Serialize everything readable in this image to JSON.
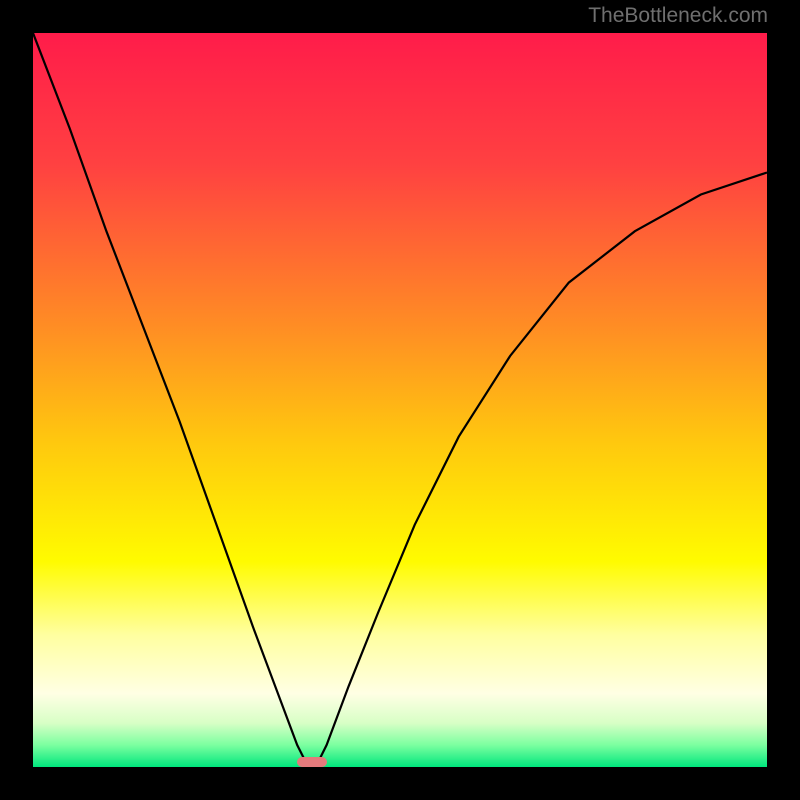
{
  "watermark": "TheBottleneck.com",
  "chart_data": {
    "type": "line",
    "title": "",
    "xlabel": "",
    "ylabel": "",
    "xlim": [
      0,
      100
    ],
    "ylim": [
      0,
      100
    ],
    "minimum_x": 38,
    "marker": {
      "x": 38,
      "width": 4
    },
    "series": [
      {
        "name": "curve",
        "x": [
          0,
          5,
          10,
          15,
          20,
          25,
          30,
          33,
          36,
          37,
          38,
          39,
          40,
          43,
          47,
          52,
          58,
          65,
          73,
          82,
          91,
          100
        ],
        "y": [
          100,
          87,
          73,
          60,
          47,
          33,
          19,
          11,
          3,
          1,
          0,
          1,
          3,
          11,
          21,
          33,
          45,
          56,
          66,
          73,
          78,
          81
        ]
      }
    ],
    "gradient_stops": [
      {
        "pos": 0,
        "color": "#ff1c4a"
      },
      {
        "pos": 18,
        "color": "#ff4141"
      },
      {
        "pos": 40,
        "color": "#ff8d24"
      },
      {
        "pos": 56,
        "color": "#ffc90e"
      },
      {
        "pos": 72,
        "color": "#fffb00"
      },
      {
        "pos": 82,
        "color": "#ffffa0"
      },
      {
        "pos": 90,
        "color": "#ffffe4"
      },
      {
        "pos": 94,
        "color": "#d8ffc6"
      },
      {
        "pos": 97,
        "color": "#7cffa0"
      },
      {
        "pos": 100,
        "color": "#00e67d"
      }
    ]
  }
}
